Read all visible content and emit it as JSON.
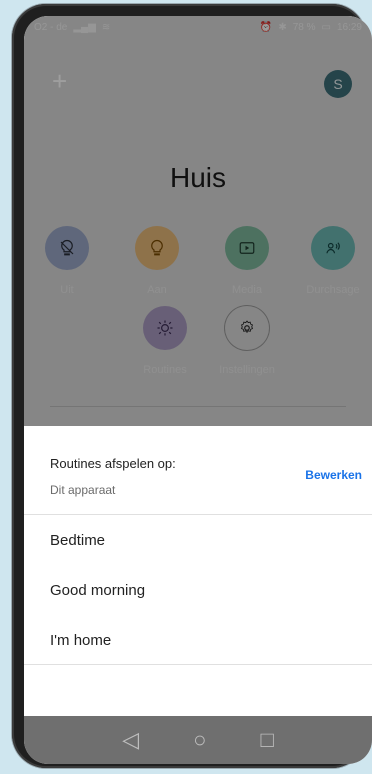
{
  "status_bar": {
    "left": "O2 - de",
    "right": "78 %",
    "time": "16:29"
  },
  "header": {
    "add_label": "+",
    "avatar_initial": "S"
  },
  "home": {
    "title": "Huis",
    "actions": [
      {
        "label": "Uit",
        "icon": "light-off-icon",
        "color": "#9aa7c7"
      },
      {
        "label": "Aan",
        "icon": "light-on-icon",
        "color": "#e6b878"
      },
      {
        "label": "Media",
        "icon": "media-icon",
        "color": "#7cb79b"
      },
      {
        "label": "Durchsage",
        "icon": "broadcast-icon",
        "color": "#6bb6b2"
      },
      {
        "label": "Routines",
        "icon": "routines-icon",
        "color": "#a99ac0"
      },
      {
        "label": "Instellingen",
        "icon": "settings-icon",
        "color": "#d9d9d9"
      }
    ]
  },
  "sheet": {
    "title": "Routines afspelen op:",
    "subtitle": "Dit apparaat",
    "edit_label": "Bewerken",
    "routines": [
      "Bedtime",
      "Good morning",
      "I'm home"
    ]
  },
  "nav": {
    "back_icon": "back-icon",
    "home_icon": "home-icon",
    "recents_icon": "recents-icon"
  }
}
